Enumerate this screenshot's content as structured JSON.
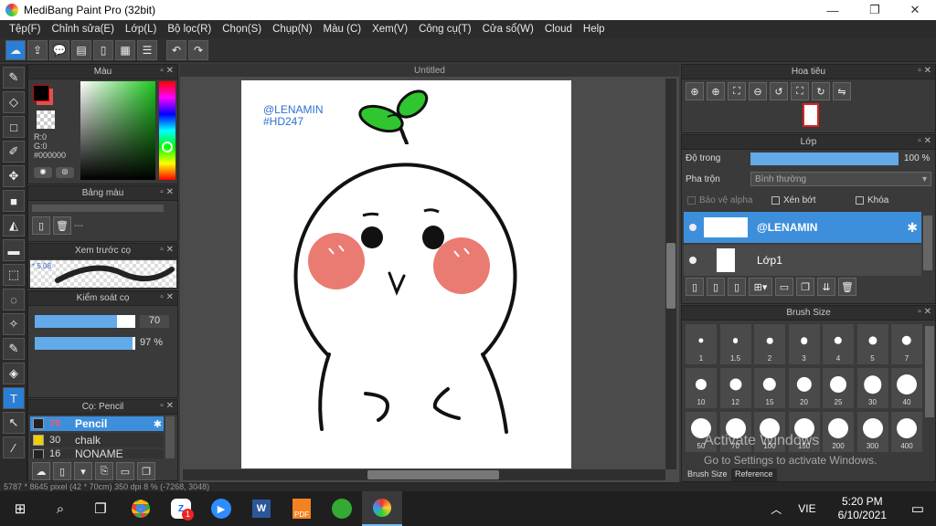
{
  "window": {
    "title": "MediBang Paint Pro (32bit)"
  },
  "menu": [
    "Tệp(F)",
    "Chỉnh sửa(E)",
    "Lớp(L)",
    "Bộ lọc(R)",
    "Chọn(S)",
    "Chụp(N)",
    "Màu (C)",
    "Xem(V)",
    "Công cụ(T)",
    "Cửa sổ(W)",
    "Cloud",
    "Help"
  ],
  "color_panel": {
    "title": "Màu",
    "r": "R:0",
    "g": "G:0",
    "hex": "#000000",
    "foreground": "#000000",
    "background": "#e05050"
  },
  "palette_panel": {
    "title": "Bảng màu",
    "value": "---"
  },
  "brush_preview": {
    "title": "Xem trước cọ",
    "size": "5.08"
  },
  "brush_control": {
    "title": "Kiểm soát cọ",
    "size_value": "70",
    "size_level": 0.82,
    "opacity_value": "97 %",
    "opacity_level": 0.97
  },
  "brush_list": {
    "title": "Cọ: Pencil",
    "items": [
      {
        "size": "70",
        "name": "Pencil",
        "color": "#222222"
      },
      {
        "size": "30",
        "name": "chalk",
        "color": "#f0d000"
      },
      {
        "size": "16",
        "name": "NONAME",
        "color": "#222222"
      }
    ]
  },
  "canvas": {
    "tab": "Untitled",
    "watermark1": "@LENAMIN",
    "watermark2": "#HD247"
  },
  "navigator": {
    "title": "Hoa tiêu"
  },
  "layers": {
    "title": "Lớp",
    "opacity_label": "Độ trong",
    "opacity_value": "100 %",
    "opacity_level": 1.0,
    "blend_label": "Pha trộn",
    "blend_value": "Bình thường",
    "protect_alpha": "Bảo vệ alpha",
    "clip": "Xén bớt",
    "lock": "Khóa",
    "items": [
      {
        "name": "@LENAMIN"
      },
      {
        "name": "Lớp1"
      }
    ]
  },
  "brush_size": {
    "title": "Brush Size",
    "sizes": [
      "1",
      "1.5",
      "2",
      "3",
      "4",
      "5",
      "7",
      "10",
      "12",
      "15",
      "20",
      "25",
      "30",
      "40",
      "50",
      "70",
      "100",
      "150",
      "200",
      "300",
      "400"
    ],
    "tabs": [
      "Brush Size",
      "Reference"
    ]
  },
  "status": {
    "text": "5787 * 8645 pixel   (42 * 70cm)   350 dpi   8 %   (-7268, 3048)"
  },
  "activation": {
    "line1": "Activate Windows",
    "line2": "Go to Settings to activate Windows."
  },
  "taskbar": {
    "lang": "VIE",
    "time": "5:20 PM",
    "date": "6/10/2021",
    "badge": "1"
  }
}
